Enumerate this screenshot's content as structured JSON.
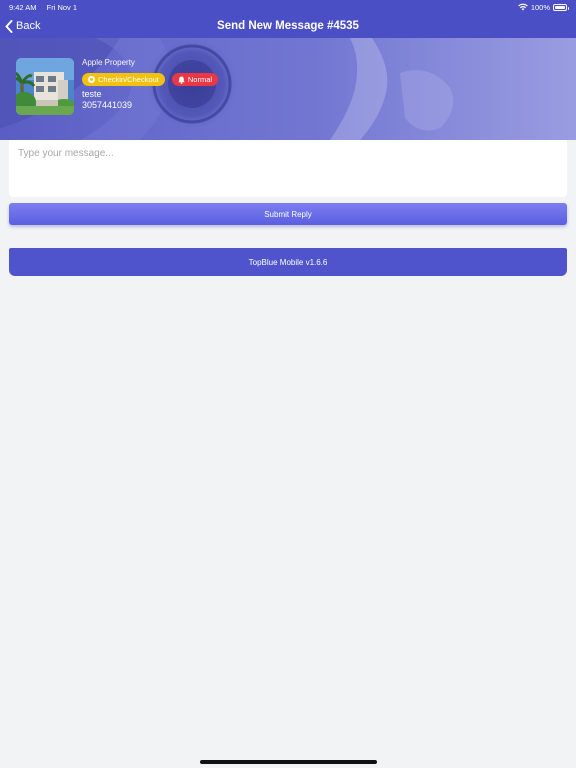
{
  "status_bar": {
    "time": "9:42 AM",
    "date": "Fri Nov 1",
    "battery": "100%",
    "battery_level": 1.0
  },
  "nav": {
    "back_label": "Back",
    "title": "Send New Message #4535"
  },
  "property": {
    "name": "Apple Property",
    "badges": [
      {
        "label": "Checkin/Checkout",
        "color": "#f2c10f",
        "icon": "circle-icon"
      },
      {
        "label": "Normal",
        "color": "#e93746",
        "icon": "bell-icon"
      }
    ],
    "guest_name": "teste",
    "guest_phone": "3057441039"
  },
  "message": {
    "value": "",
    "placeholder": "Type your message..."
  },
  "submit": {
    "label": "Submit Reply"
  },
  "footer": {
    "version": "TopBlue Mobile v1.6.6"
  },
  "colors": {
    "header": "#4a4fc6",
    "button": "#6a6ee8",
    "footer_bar": "#5054cc",
    "background": "#f2f3f5"
  }
}
